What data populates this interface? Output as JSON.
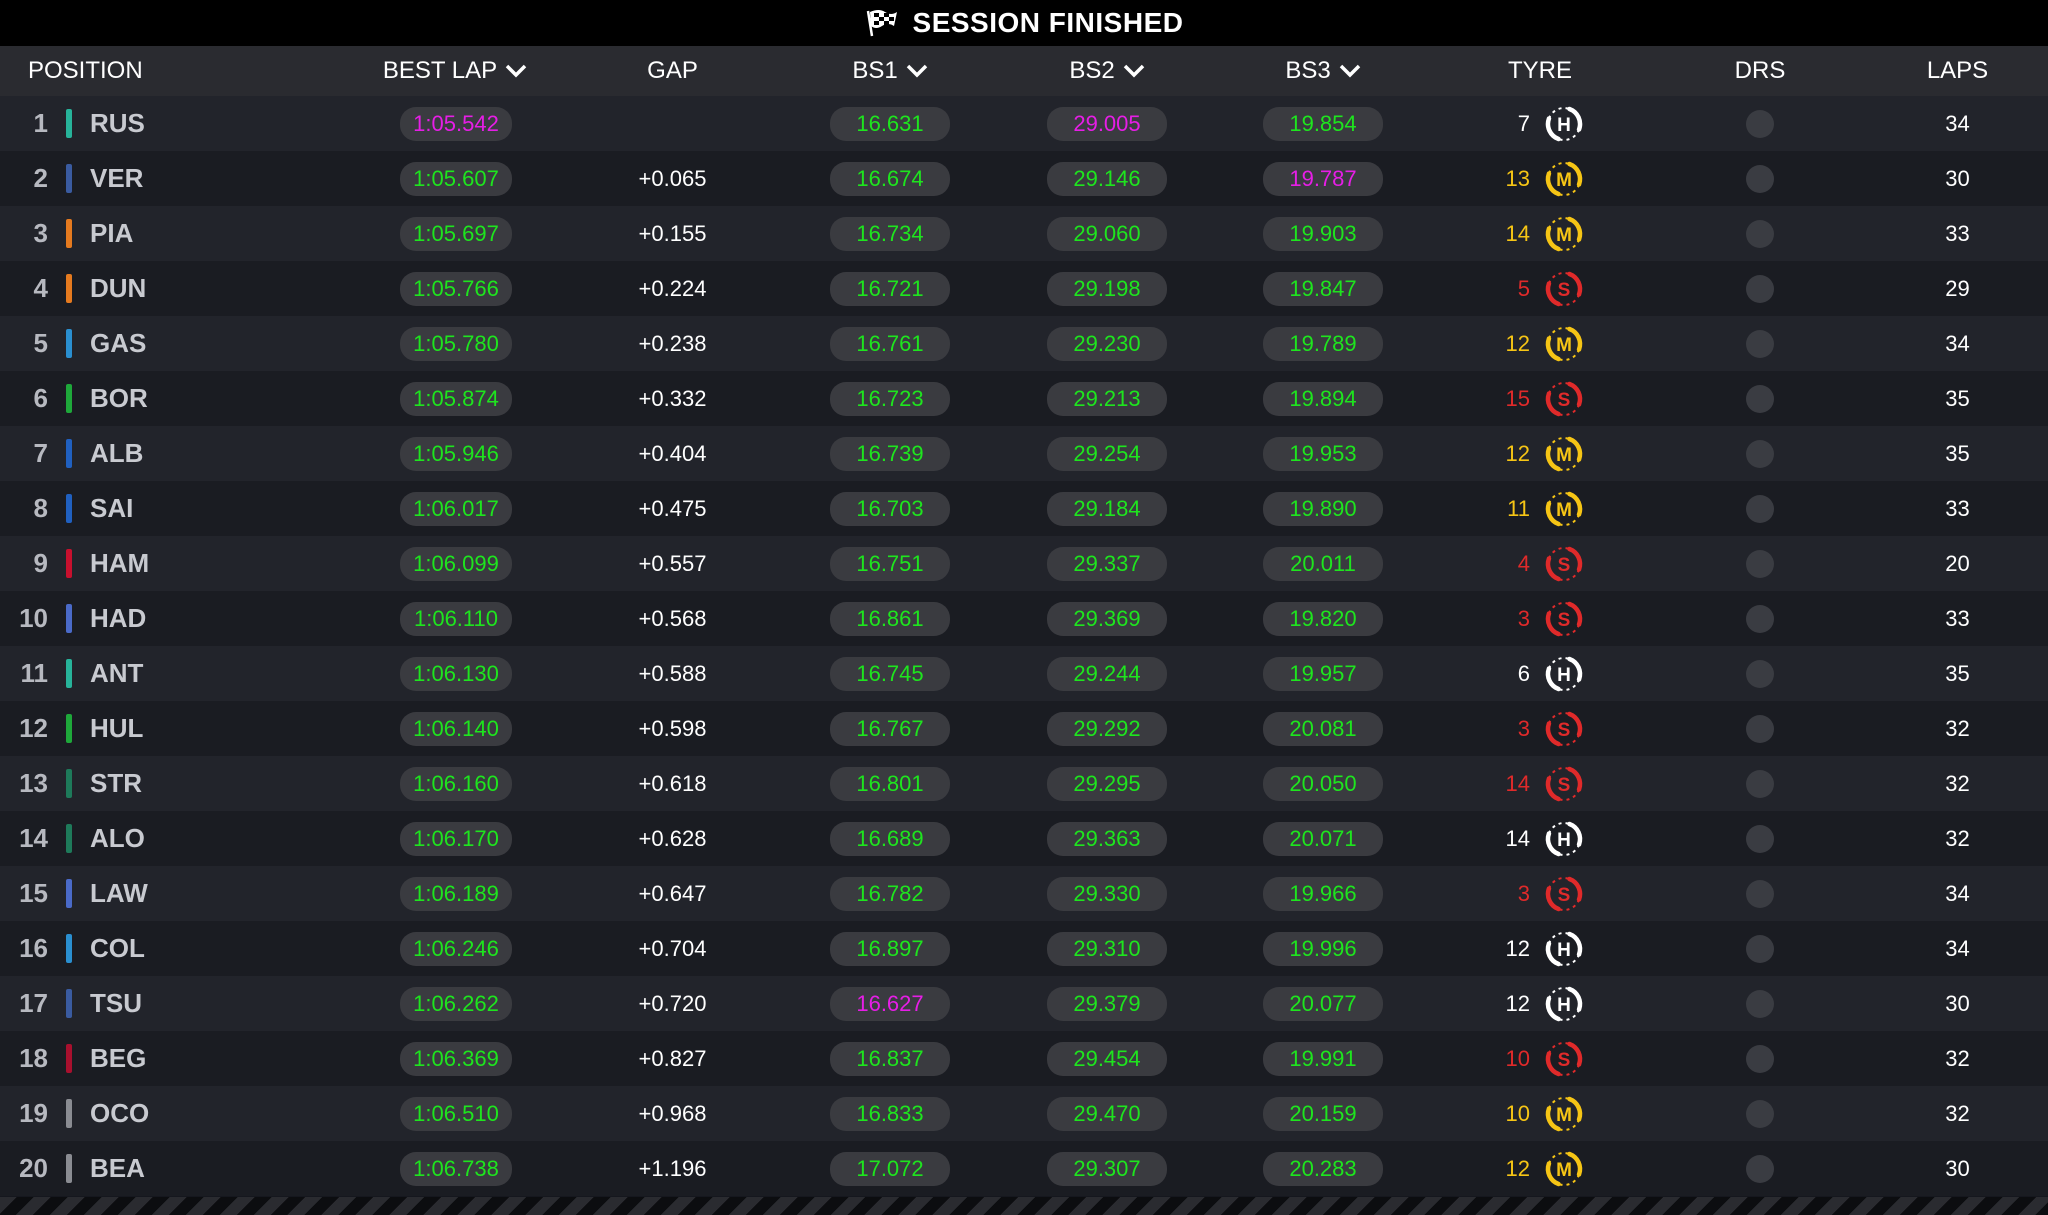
{
  "header_bar": {
    "title": "SESSION FINISHED",
    "flag_icon": "checkered-flag-icon"
  },
  "columns": {
    "position": "POSITION",
    "best_lap": "BEST LAP",
    "gap": "GAP",
    "bs1": "BS1",
    "bs2": "BS2",
    "bs3": "BS3",
    "tyre": "TYRE",
    "drs": "DRS",
    "laps": "LAPS"
  },
  "colors": {
    "personal_best": "#1ee51e",
    "overall_best": "#e61ee6",
    "soft": "#e02a2a",
    "medium": "#f6c515",
    "hard": "#ffffff"
  },
  "rows": [
    {
      "pos": "1",
      "code": "RUS",
      "team_color": "#27b39a",
      "best_lap": "1:05.542",
      "best_lap_color": "purple",
      "gap": "",
      "bs1": "16.631",
      "bs1_color": "green",
      "bs2": "29.005",
      "bs2_color": "purple",
      "bs3": "19.854",
      "bs3_color": "green",
      "tyre_laps": "7",
      "tyre": "H",
      "drs": "",
      "laps": "34"
    },
    {
      "pos": "2",
      "code": "VER",
      "team_color": "#3a5ba0",
      "best_lap": "1:05.607",
      "best_lap_color": "green",
      "gap": "+0.065",
      "bs1": "16.674",
      "bs1_color": "green",
      "bs2": "29.146",
      "bs2_color": "green",
      "bs3": "19.787",
      "bs3_color": "purple",
      "tyre_laps": "13",
      "tyre": "M",
      "drs": "",
      "laps": "30"
    },
    {
      "pos": "3",
      "code": "PIA",
      "team_color": "#e57a1f",
      "best_lap": "1:05.697",
      "best_lap_color": "green",
      "gap": "+0.155",
      "bs1": "16.734",
      "bs1_color": "green",
      "bs2": "29.060",
      "bs2_color": "green",
      "bs3": "19.903",
      "bs3_color": "green",
      "tyre_laps": "14",
      "tyre": "M",
      "drs": "",
      "laps": "33"
    },
    {
      "pos": "4",
      "code": "DUN",
      "team_color": "#e57a1f",
      "best_lap": "1:05.766",
      "best_lap_color": "green",
      "gap": "+0.224",
      "bs1": "16.721",
      "bs1_color": "green",
      "bs2": "29.198",
      "bs2_color": "green",
      "bs3": "19.847",
      "bs3_color": "green",
      "tyre_laps": "5",
      "tyre": "S",
      "drs": "",
      "laps": "29"
    },
    {
      "pos": "5",
      "code": "GAS",
      "team_color": "#2a8fd0",
      "best_lap": "1:05.780",
      "best_lap_color": "green",
      "gap": "+0.238",
      "bs1": "16.761",
      "bs1_color": "green",
      "bs2": "29.230",
      "bs2_color": "green",
      "bs3": "19.789",
      "bs3_color": "green",
      "tyre_laps": "12",
      "tyre": "M",
      "drs": "",
      "laps": "34"
    },
    {
      "pos": "6",
      "code": "BOR",
      "team_color": "#1ea83a",
      "best_lap": "1:05.874",
      "best_lap_color": "green",
      "gap": "+0.332",
      "bs1": "16.723",
      "bs1_color": "green",
      "bs2": "29.213",
      "bs2_color": "green",
      "bs3": "19.894",
      "bs3_color": "green",
      "tyre_laps": "15",
      "tyre": "S",
      "drs": "",
      "laps": "35"
    },
    {
      "pos": "7",
      "code": "ALB",
      "team_color": "#2060c0",
      "best_lap": "1:05.946",
      "best_lap_color": "green",
      "gap": "+0.404",
      "bs1": "16.739",
      "bs1_color": "green",
      "bs2": "29.254",
      "bs2_color": "green",
      "bs3": "19.953",
      "bs3_color": "green",
      "tyre_laps": "12",
      "tyre": "M",
      "drs": "",
      "laps": "35"
    },
    {
      "pos": "8",
      "code": "SAI",
      "team_color": "#2060c0",
      "best_lap": "1:06.017",
      "best_lap_color": "green",
      "gap": "+0.475",
      "bs1": "16.703",
      "bs1_color": "green",
      "bs2": "29.184",
      "bs2_color": "green",
      "bs3": "19.890",
      "bs3_color": "green",
      "tyre_laps": "11",
      "tyre": "M",
      "drs": "",
      "laps": "33"
    },
    {
      "pos": "9",
      "code": "HAM",
      "team_color": "#c8102e",
      "best_lap": "1:06.099",
      "best_lap_color": "green",
      "gap": "+0.557",
      "bs1": "16.751",
      "bs1_color": "green",
      "bs2": "29.337",
      "bs2_color": "green",
      "bs3": "20.011",
      "bs3_color": "green",
      "tyre_laps": "4",
      "tyre": "S",
      "drs": "",
      "laps": "20"
    },
    {
      "pos": "10",
      "code": "HAD",
      "team_color": "#4a6ac8",
      "best_lap": "1:06.110",
      "best_lap_color": "green",
      "gap": "+0.568",
      "bs1": "16.861",
      "bs1_color": "green",
      "bs2": "29.369",
      "bs2_color": "green",
      "bs3": "19.820",
      "bs3_color": "green",
      "tyre_laps": "3",
      "tyre": "S",
      "drs": "",
      "laps": "33"
    },
    {
      "pos": "11",
      "code": "ANT",
      "team_color": "#27b39a",
      "best_lap": "1:06.130",
      "best_lap_color": "green",
      "gap": "+0.588",
      "bs1": "16.745",
      "bs1_color": "green",
      "bs2": "29.244",
      "bs2_color": "green",
      "bs3": "19.957",
      "bs3_color": "green",
      "tyre_laps": "6",
      "tyre": "H",
      "drs": "",
      "laps": "35"
    },
    {
      "pos": "12",
      "code": "HUL",
      "team_color": "#1ea83a",
      "best_lap": "1:06.140",
      "best_lap_color": "green",
      "gap": "+0.598",
      "bs1": "16.767",
      "bs1_color": "green",
      "bs2": "29.292",
      "bs2_color": "green",
      "bs3": "20.081",
      "bs3_color": "green",
      "tyre_laps": "3",
      "tyre": "S",
      "drs": "",
      "laps": "32"
    },
    {
      "pos": "13",
      "code": "STR",
      "team_color": "#1e7a5a",
      "best_lap": "1:06.160",
      "best_lap_color": "green",
      "gap": "+0.618",
      "bs1": "16.801",
      "bs1_color": "green",
      "bs2": "29.295",
      "bs2_color": "green",
      "bs3": "20.050",
      "bs3_color": "green",
      "tyre_laps": "14",
      "tyre": "S",
      "drs": "",
      "laps": "32"
    },
    {
      "pos": "14",
      "code": "ALO",
      "team_color": "#1e7a5a",
      "best_lap": "1:06.170",
      "best_lap_color": "green",
      "gap": "+0.628",
      "bs1": "16.689",
      "bs1_color": "green",
      "bs2": "29.363",
      "bs2_color": "green",
      "bs3": "20.071",
      "bs3_color": "green",
      "tyre_laps": "14",
      "tyre": "H",
      "drs": "",
      "laps": "32"
    },
    {
      "pos": "15",
      "code": "LAW",
      "team_color": "#4a6ac8",
      "best_lap": "1:06.189",
      "best_lap_color": "green",
      "gap": "+0.647",
      "bs1": "16.782",
      "bs1_color": "green",
      "bs2": "29.330",
      "bs2_color": "green",
      "bs3": "19.966",
      "bs3_color": "green",
      "tyre_laps": "3",
      "tyre": "S",
      "drs": "",
      "laps": "34"
    },
    {
      "pos": "16",
      "code": "COL",
      "team_color": "#2a8fd0",
      "best_lap": "1:06.246",
      "best_lap_color": "green",
      "gap": "+0.704",
      "bs1": "16.897",
      "bs1_color": "green",
      "bs2": "29.310",
      "bs2_color": "green",
      "bs3": "19.996",
      "bs3_color": "green",
      "tyre_laps": "12",
      "tyre": "H",
      "drs": "",
      "laps": "34"
    },
    {
      "pos": "17",
      "code": "TSU",
      "team_color": "#3a5ba0",
      "best_lap": "1:06.262",
      "best_lap_color": "green",
      "gap": "+0.720",
      "bs1": "16.627",
      "bs1_color": "purple",
      "bs2": "29.379",
      "bs2_color": "green",
      "bs3": "20.077",
      "bs3_color": "green",
      "tyre_laps": "12",
      "tyre": "H",
      "drs": "",
      "laps": "30"
    },
    {
      "pos": "18",
      "code": "BEG",
      "team_color": "#a8102e",
      "best_lap": "1:06.369",
      "best_lap_color": "green",
      "gap": "+0.827",
      "bs1": "16.837",
      "bs1_color": "green",
      "bs2": "29.454",
      "bs2_color": "green",
      "bs3": "19.991",
      "bs3_color": "green",
      "tyre_laps": "10",
      "tyre": "S",
      "drs": "",
      "laps": "32"
    },
    {
      "pos": "19",
      "code": "OCO",
      "team_color": "#8a8c92",
      "best_lap": "1:06.510",
      "best_lap_color": "green",
      "gap": "+0.968",
      "bs1": "16.833",
      "bs1_color": "green",
      "bs2": "29.470",
      "bs2_color": "green",
      "bs3": "20.159",
      "bs3_color": "green",
      "tyre_laps": "10",
      "tyre": "M",
      "drs": "",
      "laps": "32"
    },
    {
      "pos": "20",
      "code": "BEA",
      "team_color": "#8a8c92",
      "best_lap": "1:06.738",
      "best_lap_color": "green",
      "gap": "+1.196",
      "bs1": "17.072",
      "bs1_color": "green",
      "bs2": "29.307",
      "bs2_color": "green",
      "bs3": "20.283",
      "bs3_color": "green",
      "tyre_laps": "12",
      "tyre": "M",
      "drs": "",
      "laps": "30"
    }
  ]
}
